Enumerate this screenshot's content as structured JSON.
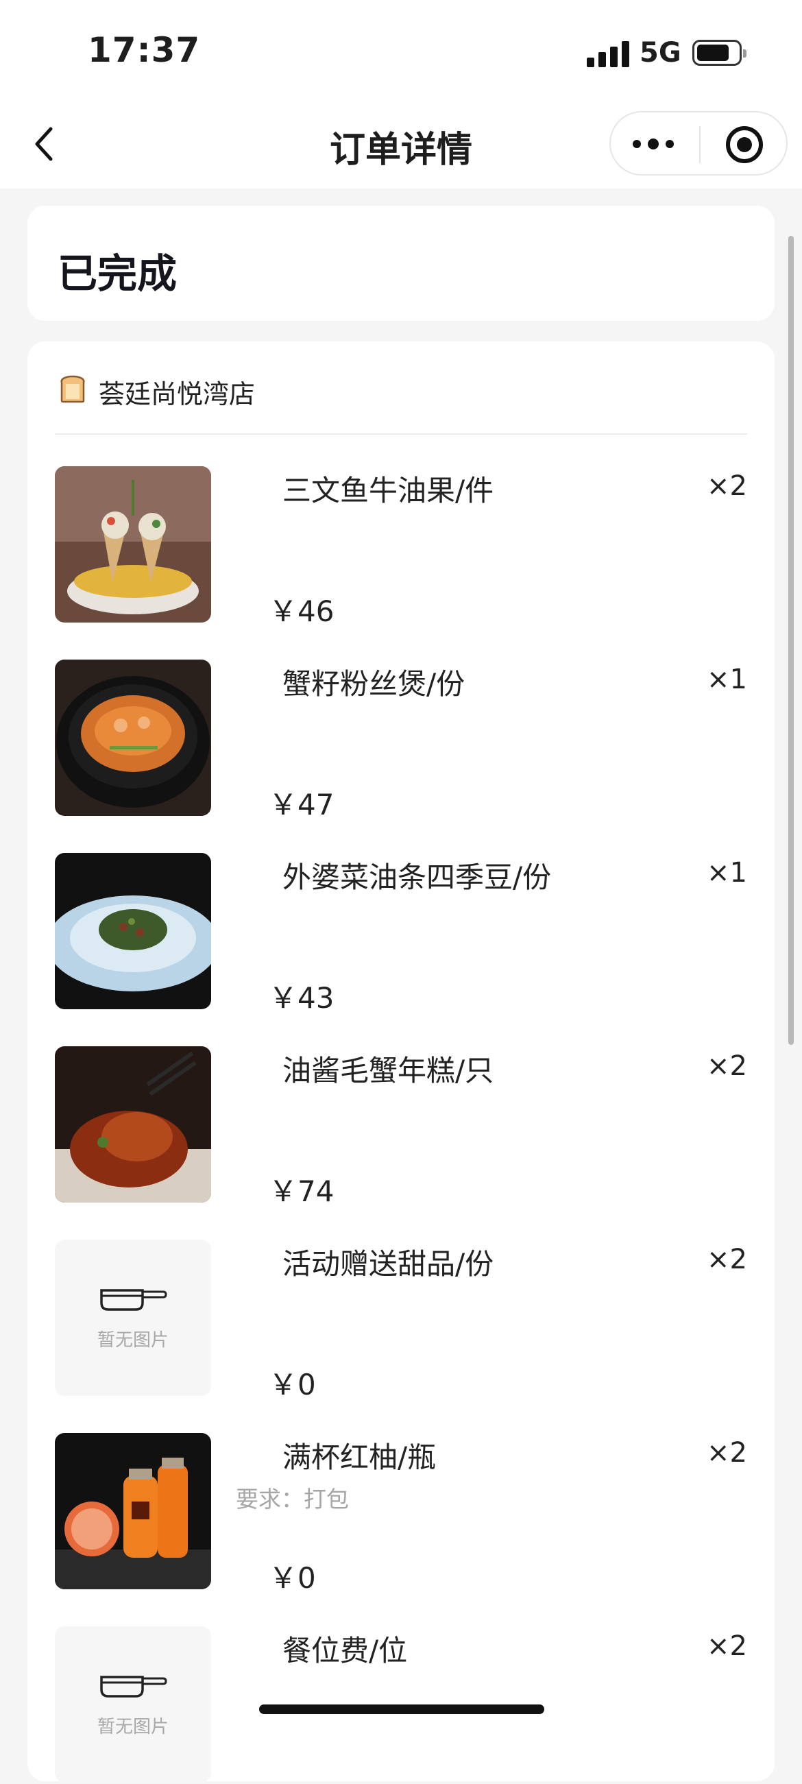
{
  "status_bar": {
    "time": "17:37",
    "network": "5G",
    "battery_percent": 70
  },
  "nav": {
    "title": "订单详情",
    "back_icon": "chevron-left-icon",
    "more_icon": "more-dots-icon",
    "close_icon": "target-circle-icon"
  },
  "order": {
    "status": "已完成",
    "store": {
      "name": "荟廷尚悦湾店",
      "icon": "bread-icon"
    },
    "items": [
      {
        "name": "三文鱼牛油果/件",
        "quantity": "×2",
        "price": "￥46",
        "note": "",
        "image": "photo"
      },
      {
        "name": "蟹籽粉丝煲/份",
        "quantity": "×1",
        "price": "￥47",
        "note": "",
        "image": "photo"
      },
      {
        "name": "外婆菜油条四季豆/份",
        "quantity": "×1",
        "price": "￥43",
        "note": "",
        "image": "photo"
      },
      {
        "name": "油酱毛蟹年糕/只",
        "quantity": "×2",
        "price": "￥74",
        "note": "",
        "image": "photo"
      },
      {
        "name": "活动赠送甜品/份",
        "quantity": "×2",
        "price": "￥0",
        "note": "",
        "image": "placeholder",
        "placeholder_text": "暂无图片"
      },
      {
        "name": "满杯红柚/瓶",
        "quantity": "×2",
        "price": "￥0",
        "note": "要求：打包",
        "image": "photo"
      },
      {
        "name": "餐位费/位",
        "quantity": "×2",
        "price": "",
        "note": "",
        "image": "placeholder",
        "placeholder_text": "暂无图片"
      }
    ]
  }
}
